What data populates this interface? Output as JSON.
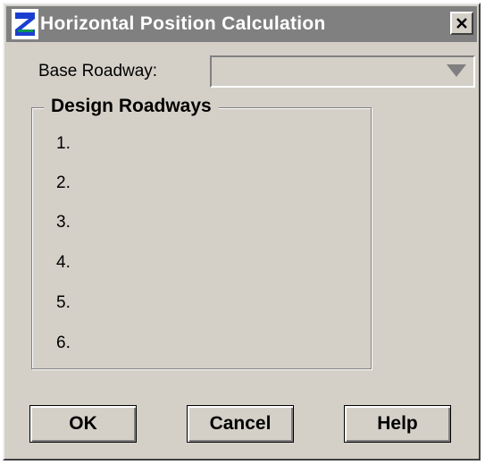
{
  "window": {
    "title": "Horizontal Position Calculation",
    "close_glyph": "✕",
    "app_icon": "roadway-s-icon"
  },
  "base_roadway": {
    "label": "Base Roadway:",
    "value": ""
  },
  "design_roadways": {
    "title": "Design Roadways",
    "rows": [
      "1.",
      "2.",
      "3.",
      "4.",
      "5.",
      "6."
    ]
  },
  "buttons": {
    "ok": "OK",
    "cancel": "Cancel",
    "help": "Help"
  },
  "colors": {
    "dialog_face": "#d4d0c8",
    "inactive_titlebar": "#808080",
    "title_text": "#ffffff",
    "icon_blue": "#1a3fd0",
    "icon_green": "#00a040"
  }
}
